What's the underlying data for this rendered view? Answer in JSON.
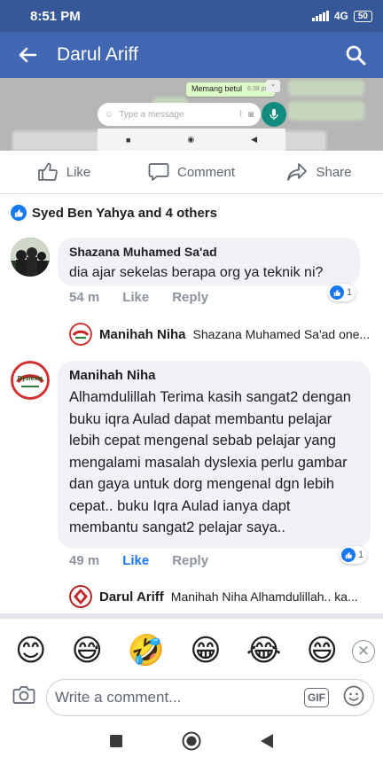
{
  "status_bar": {
    "time": "8:51 PM",
    "network": "4G",
    "battery": "50"
  },
  "app_bar": {
    "title": "Darul Ariff"
  },
  "video_preview": {
    "message_text": "Memang betul",
    "message_time": "6:38 pm",
    "input_placeholder": "Type a message"
  },
  "actions": {
    "like": "Like",
    "comment": "Comment",
    "share": "Share"
  },
  "reactions_summary": "Syed Ben Yahya and 4 others",
  "comments": [
    {
      "author": "Shazana Muhamed Sa'ad",
      "text": "dia ajar sekelas berapa org ya teknik ni?",
      "time": "54 m",
      "like": "Like",
      "reply": "Reply",
      "reaction_count": "1",
      "reply_preview": {
        "author": "Manihah Niha",
        "snippet": "Shazana Muhamed Sa'ad one..."
      }
    },
    {
      "author": "Manihah Niha",
      "text": "Alhamdulillah Terima kasih sangat2 dengan buku iqra Aulad dapat membantu pelajar lebih cepat mengenal sebab pelajar yang mengalami masalah dyslexia perlu  gambar dan gaya untuk dorg mengenal dgn lebih cepat..  buku Iqra Aulad ianya dapt membantu sangat2 pelajar saya..",
      "time": "49 m",
      "like": "Like",
      "reply": "Reply",
      "reaction_count": "1",
      "reply_preview": {
        "author": "Darul Ariff",
        "snippet": "Manihah Niha Alhamdulillah.. ka..."
      }
    }
  ],
  "emoji_bar": [
    "😊",
    "😅",
    "🤣",
    "😁",
    "😂",
    "😄"
  ],
  "composer": {
    "placeholder": "Write a comment...",
    "gif_label": "GIF"
  },
  "colors": {
    "header": "#4267b2",
    "status_bar": "#365899",
    "accent": "#1877f2",
    "bubble": "#f0f2f5"
  }
}
